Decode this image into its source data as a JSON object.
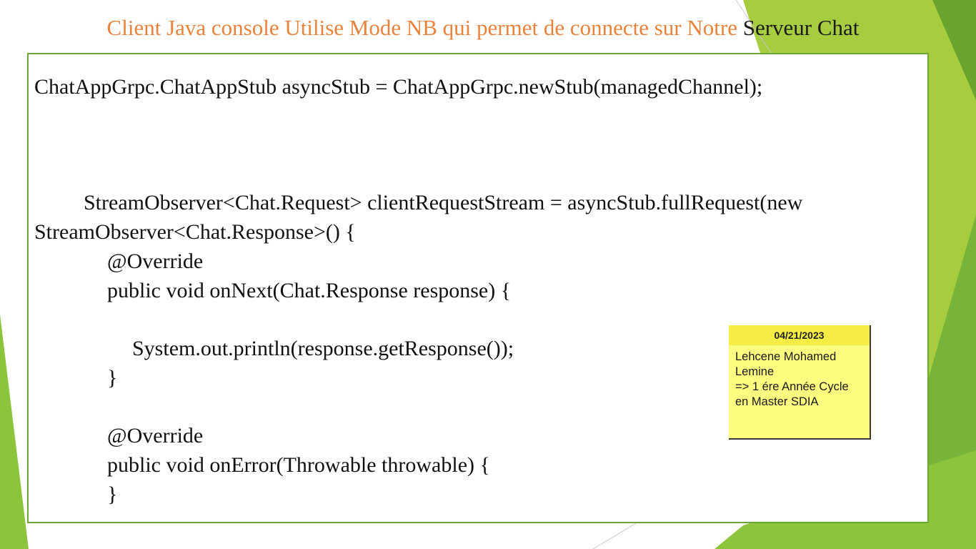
{
  "slide": {
    "title_part1": "Client Java console Utilise Mode NB qui permet de connecte sur Notre",
    "title_part2": "Serveur Chat"
  },
  "code": {
    "lines": [
      "ChatAppGrpc.ChatAppStub asyncStub = ChatAppGrpc.newStub(managedChannel);",
      "StreamObserver<Chat.Request> clientRequestStream = asyncStub.fullRequest(new",
      "StreamObserver<Chat.Response>() {",
      "@Override",
      "public void onNext(Chat.Response response) {",
      "System.out.println(response.getResponse());",
      "}",
      "@Override",
      "public void onError(Throwable throwable) {",
      "}"
    ]
  },
  "note": {
    "date": "04/21/2023",
    "lines": [
      "Lehcene Mohamed",
      "Lemine",
      "=> 1 ére Année Cycle",
      "en Master SDIA"
    ]
  },
  "theme": {
    "title_accent": "#e9833b",
    "border_green": "#6aaa33",
    "note_yellow": "#fdfd80",
    "note_header_yellow": "#f7ee45"
  }
}
